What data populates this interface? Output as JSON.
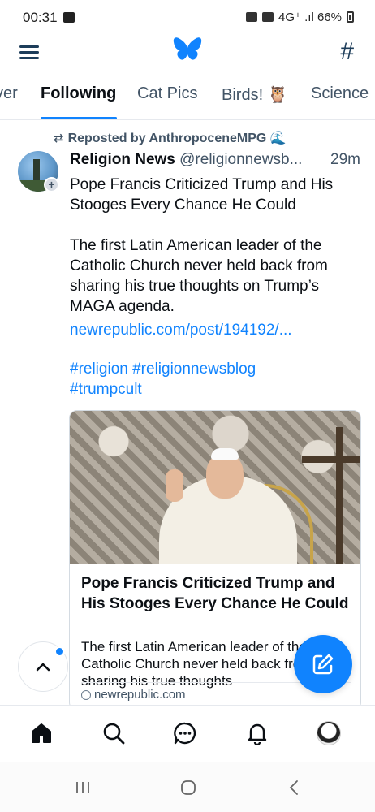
{
  "status_bar": {
    "time": "00:31",
    "right_text": "4G⁺ .ıl 66%"
  },
  "header": {
    "menu_icon": "hamburger-menu-icon",
    "logo_icon": "butterfly-logo-icon",
    "hash_symbol": "#",
    "accent_color": "#1083fe"
  },
  "tabs": [
    {
      "label": "ver"
    },
    {
      "label": "Following",
      "active": true
    },
    {
      "label": "Cat Pics"
    },
    {
      "label": "Birds! 🦉"
    },
    {
      "label": "Science"
    }
  ],
  "post": {
    "repost_label": "Reposted by AnthropoceneMPG 🌊",
    "author_name": "Religion News",
    "author_handle": "@religionnewsb...",
    "time": "29m",
    "text_paragraph_1": "Pope Francis Criticized Trump and His Stooges Every Chance He Could",
    "text_paragraph_2": "The first Latin American leader of the Catholic Church never held back from sharing his true thoughts on Trump’s MAGA agenda.",
    "link": "newrepublic.com/post/194192/...",
    "hashtags_line_1": "#religion #religionnewsblog",
    "hashtags_line_2": "#trumpcult",
    "card": {
      "title": "Pope Francis Criticized Trump and His Stooges Every Chance He Could",
      "description": "The first Latin American leader of the Catholic Church never held back from sharing his true thoughts",
      "domain": "newrepublic.com"
    }
  },
  "bottom_nav": [
    {
      "icon": "home-icon"
    },
    {
      "icon": "search-icon"
    },
    {
      "icon": "chat-icon"
    },
    {
      "icon": "bell-icon"
    },
    {
      "icon": "profile-avatar"
    }
  ],
  "system_nav": [
    "recent-apps-icon",
    "home-circle-icon",
    "back-icon"
  ]
}
